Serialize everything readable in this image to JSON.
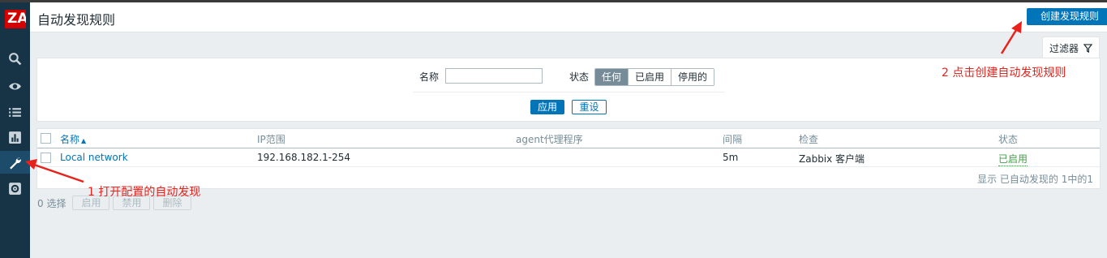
{
  "logo": "ZA",
  "header": {
    "title": "自动发现规则",
    "create_button": "创建发现规则"
  },
  "sidebar": {
    "items": [
      {
        "icon": "search-icon"
      },
      {
        "icon": "eye-icon"
      },
      {
        "icon": "list-icon"
      },
      {
        "icon": "chart-icon"
      },
      {
        "icon": "wrench-icon",
        "active": true
      },
      {
        "icon": "gear-icon"
      }
    ]
  },
  "filter": {
    "tab_label": "过滤器",
    "name_label": "名称",
    "name_value": "",
    "status_label": "状态",
    "status_options": [
      "任何",
      "已启用",
      "停用的"
    ],
    "status_selected": "任何",
    "apply": "应用",
    "reset": "重设"
  },
  "table": {
    "columns": [
      "名称",
      "IP范围",
      "agent代理程序",
      "间隔",
      "检查",
      "状态"
    ],
    "sort_indicator": "▲",
    "rows": [
      {
        "name": "Local network",
        "ip_range": "192.168.182.1-254",
        "proxy": "",
        "interval": "5m",
        "checks": "Zabbix 客户端",
        "status": "已启用"
      }
    ],
    "footer": "显示 已自动发现的 1中的1"
  },
  "bulk": {
    "selected": "0 选择",
    "enable": "启用",
    "disable": "禁用",
    "delete": "删除"
  },
  "annotations": {
    "step1": "1 打开配置的自动发现",
    "step2": "2 点击创建自动发现规则"
  },
  "colors": {
    "sidebar": "#173447",
    "primary": "#0275b8",
    "annotation": "#e8211b",
    "enabled": "#429e47",
    "logo": "#d40000"
  }
}
